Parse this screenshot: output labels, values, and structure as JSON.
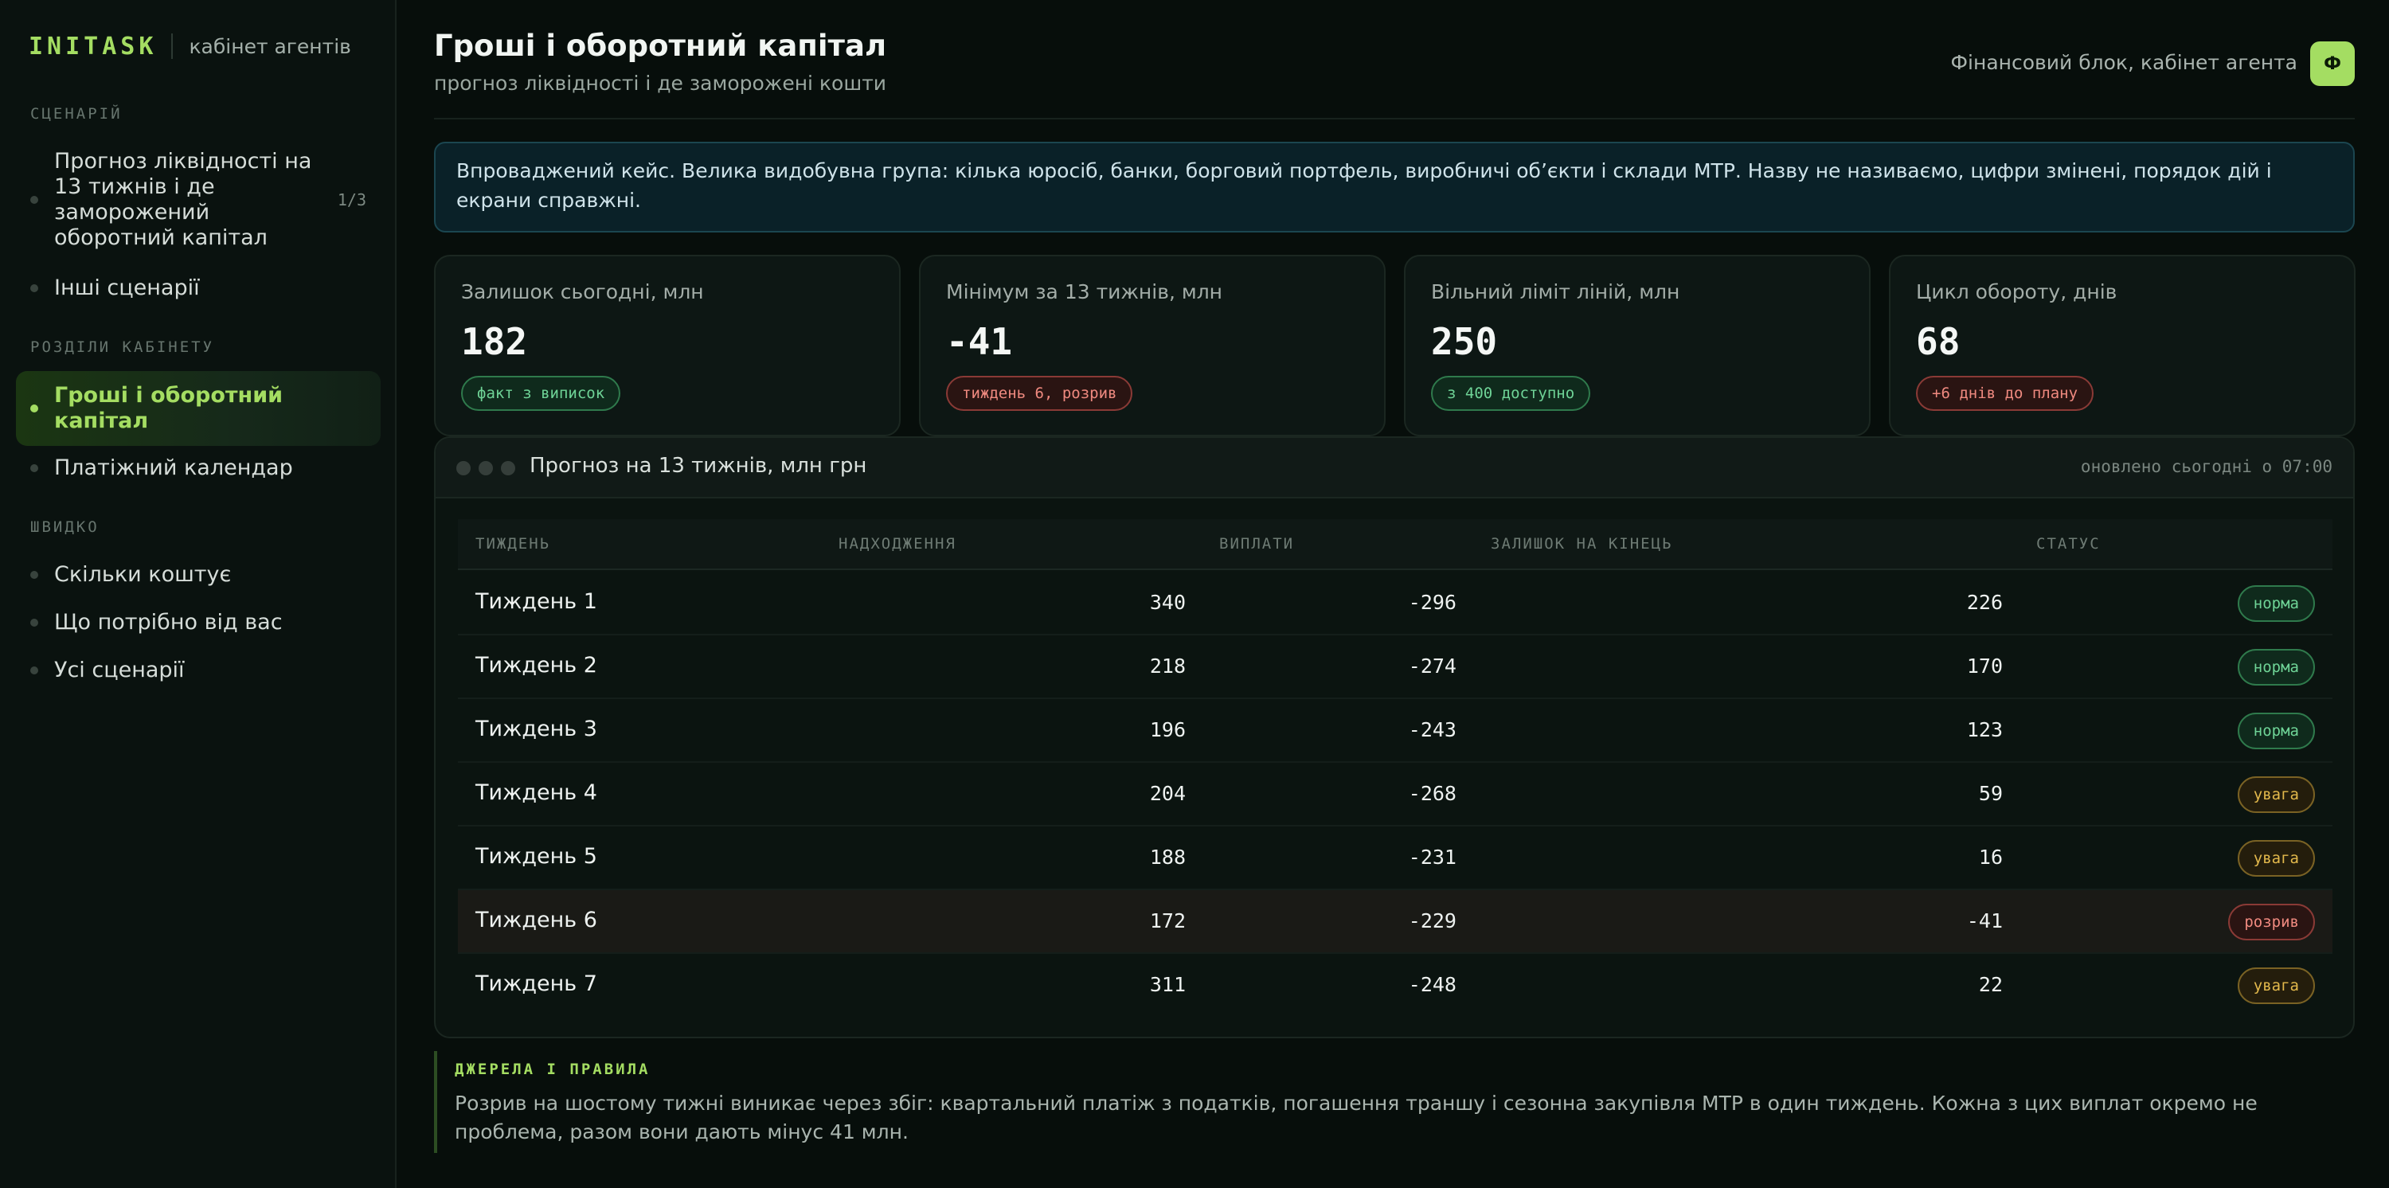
{
  "brand": {
    "logo": "INITASK",
    "subtitle": "кабінет агентів"
  },
  "sidebar": {
    "scenarios_label": "СЦЕНАРІЙ",
    "scenarios": [
      {
        "label": "Прогноз ліквідності на 13 тижнів і де заморожений оборотний капітал",
        "count": "1/3"
      },
      {
        "label": "Інші сценарії"
      }
    ],
    "sections_label": "РОЗДІЛИ КАБІНЕТУ",
    "sections": [
      {
        "label": "Гроші і оборотний капітал",
        "active": true
      },
      {
        "label": "Платіжний календар"
      }
    ],
    "quick_label": "ШВИДКО",
    "quick": [
      {
        "label": "Скільки коштує"
      },
      {
        "label": "Що потрібно від вас"
      },
      {
        "label": "Усі сценарії"
      }
    ]
  },
  "header": {
    "title": "Гроші і оборотний капітал",
    "subtitle": "прогноз ліквідності і де заморожені кошти",
    "who": "Фінансовий блок, кабінет агента",
    "avatar": "Ф"
  },
  "banner": "Впроваджений кейс. Велика видобувна група: кілька юросіб, банки, борговий портфель, виробничі об’єкти і склади МТР. Назву не називаємо, цифри змінені, порядок дій і екрани справжні.",
  "metrics": [
    {
      "label": "Залишок сьогодні, млн",
      "value": "182",
      "note": "факт з виписок",
      "tone": "green"
    },
    {
      "label": "Мінімум за 13 тижнів, млн",
      "value": "-41",
      "note": "тиждень 6, розрив",
      "tone": "red"
    },
    {
      "label": "Вільний ліміт ліній, млн",
      "value": "250",
      "note": "з 400 доступно",
      "tone": "green"
    },
    {
      "label": "Цикл обороту, днів",
      "value": "68",
      "note": "+6 днів до плану",
      "tone": "red"
    }
  ],
  "forecast": {
    "title": "Прогноз на 13 тижнів, млн грн",
    "updated": "оновлено сьогодні о 07:00",
    "columns": [
      "ТИЖДЕНЬ",
      "НАДХОДЖЕННЯ",
      "ВИПЛАТИ",
      "ЗАЛИШОК НА КІНЕЦЬ",
      "СТАТУС"
    ],
    "rows": [
      {
        "week": "Тиждень 1",
        "in": "340",
        "out": "-296",
        "balance": "226",
        "status": "норма",
        "tone": "norm"
      },
      {
        "week": "Тиждень 2",
        "in": "218",
        "out": "-274",
        "balance": "170",
        "status": "норма",
        "tone": "norm"
      },
      {
        "week": "Тиждень 3",
        "in": "196",
        "out": "-243",
        "balance": "123",
        "status": "норма",
        "tone": "norm"
      },
      {
        "week": "Тиждень 4",
        "in": "204",
        "out": "-268",
        "balance": "59",
        "status": "увага",
        "tone": "warn"
      },
      {
        "week": "Тиждень 5",
        "in": "188",
        "out": "-231",
        "balance": "16",
        "status": "увага",
        "tone": "warn"
      },
      {
        "week": "Тиждень 6",
        "in": "172",
        "out": "-229",
        "balance": "-41",
        "status": "розрив",
        "tone": "gap",
        "highlight": true
      },
      {
        "week": "Тиждень 7",
        "in": "311",
        "out": "-248",
        "balance": "22",
        "status": "увага",
        "tone": "warn"
      }
    ]
  },
  "sources": {
    "label": "ДЖЕРЕЛА І ПРАВИЛА",
    "text": "Розрив на шостому тижні виникає через збіг: квартальний платіж з податків, погашення траншу і сезонна закупівля МТР в один тиждень. Кожна з цих виплат окремо не проблема, разом вони дають мінус 41 млн."
  },
  "colors": {
    "accent": "#a4dd62",
    "ok": "#6fd497",
    "warn": "#e3b94c",
    "danger": "#f08a80"
  }
}
